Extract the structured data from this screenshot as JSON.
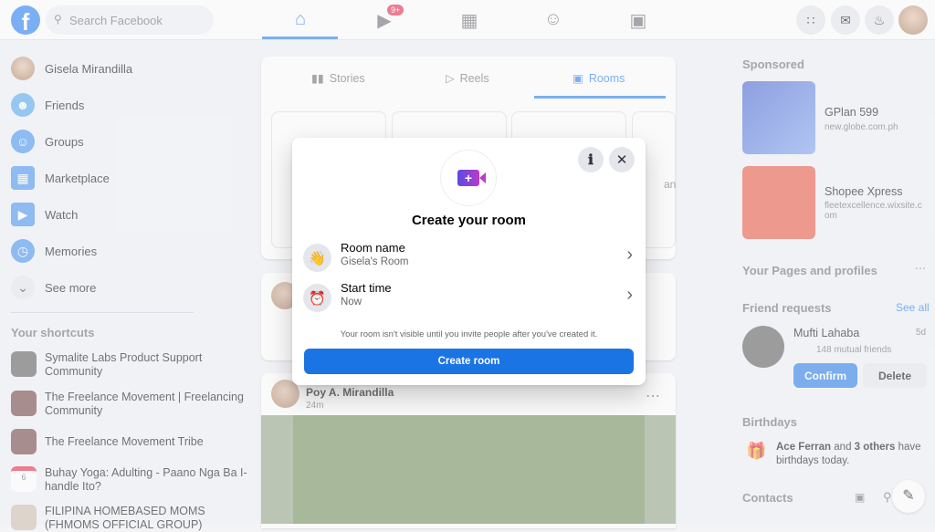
{
  "topbar": {
    "logo": "f",
    "search_placeholder": "Search Facebook",
    "watch_badge": "9+",
    "nav_icons": [
      "home-icon",
      "watch-icon",
      "marketplace-icon",
      "groups-icon",
      "gaming-icon"
    ]
  },
  "sidebar": {
    "items": [
      {
        "label": "Gisela Mirandilla",
        "icon": "avatar"
      },
      {
        "label": "Friends",
        "icon": "friends-icon"
      },
      {
        "label": "Groups",
        "icon": "groups-icon"
      },
      {
        "label": "Marketplace",
        "icon": "marketplace-icon"
      },
      {
        "label": "Watch",
        "icon": "watch-icon"
      },
      {
        "label": "Memories",
        "icon": "memories-icon"
      },
      {
        "label": "See more",
        "icon": "chevron-down-icon"
      }
    ],
    "shortcuts_title": "Your shortcuts",
    "shortcuts": [
      {
        "label": "Symalite Labs Product Support Community"
      },
      {
        "label": "The Freelance Movement | Freelancing Community"
      },
      {
        "label": "The Freelance Movement Tribe"
      },
      {
        "label": "Buhay Yoga: Adulting - Paano Nga Ba I-handle Ito?",
        "date": "6"
      },
      {
        "label": "FILIPINA HOMEBASED MOMS (FHMOMS OFFICIAL GROUP)"
      }
    ]
  },
  "feed": {
    "tabs": [
      {
        "label": "Stories"
      },
      {
        "label": "Reels"
      },
      {
        "label": "Rooms",
        "active": true
      }
    ],
    "room_card_partial": "an",
    "post": {
      "author": "Poy A. Mirandilla",
      "time": "24m"
    }
  },
  "right": {
    "sponsored_title": "Sponsored",
    "ads": [
      {
        "title": "GPlan 599",
        "url": "new.globe.com.ph"
      },
      {
        "title": "Shopee Xpress",
        "url": "fleetexcellence.wixsite.com"
      }
    ],
    "pages_title": "Your Pages and profiles",
    "friend_requests_title": "Friend requests",
    "see_all": "See all",
    "request": {
      "name": "Mufti Lahaba",
      "age": "5d",
      "mutual": "148 mutual friends",
      "confirm": "Confirm",
      "delete": "Delete"
    },
    "birthdays_title": "Birthdays",
    "birthday": {
      "name": "Ace Ferran",
      "mid": " and ",
      "others": "3 others",
      "tail": " have birthdays today."
    },
    "contacts_title": "Contacts"
  },
  "modal": {
    "title": "Create your room",
    "rows": [
      {
        "label": "Room name",
        "value": "Gisela's Room",
        "icon": "wave-icon"
      },
      {
        "label": "Start time",
        "value": "Now",
        "icon": "alarm-clock-icon"
      }
    ],
    "note": "Your room isn't visible until you invite people after you've created it.",
    "button": "Create room"
  },
  "colors": {
    "brand": "#1877f2",
    "button": "#1b74e4"
  }
}
